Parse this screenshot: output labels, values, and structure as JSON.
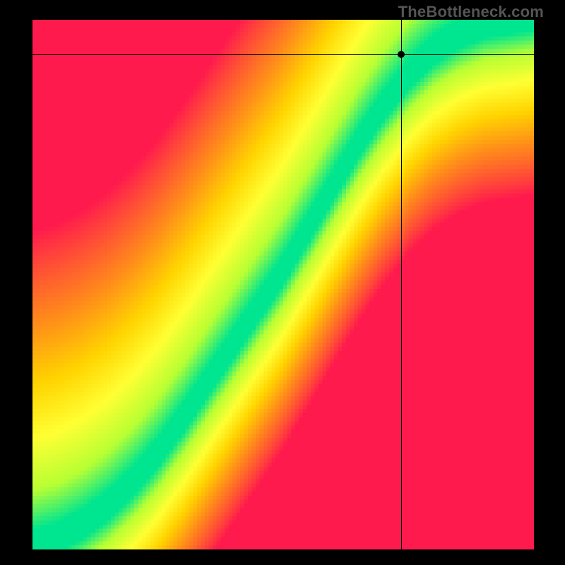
{
  "watermark": "TheBottleneck.com",
  "chart_data": {
    "type": "heatmap",
    "title": "",
    "xlabel": "",
    "ylabel": "",
    "xlim": [
      0,
      1
    ],
    "ylim": [
      0,
      1
    ],
    "grid_resolution": [
      128,
      128
    ],
    "color_scale": {
      "stops": [
        {
          "t": 0.0,
          "color": "#ff1a4d"
        },
        {
          "t": 0.35,
          "color": "#ff8c1a"
        },
        {
          "t": 0.55,
          "color": "#ffd400"
        },
        {
          "t": 0.72,
          "color": "#ffff33"
        },
        {
          "t": 0.88,
          "color": "#b7ff33"
        },
        {
          "t": 1.0,
          "color": "#00e58f"
        }
      ]
    },
    "optimal_curve": {
      "description": "Ideal-balance ridge (x = normalized CPU capability, y = normalized GPU capability). Heat value falls off with distance from this curve.",
      "points": [
        {
          "x": 0.0,
          "y": 0.0
        },
        {
          "x": 0.05,
          "y": 0.015
        },
        {
          "x": 0.1,
          "y": 0.04
        },
        {
          "x": 0.15,
          "y": 0.075
        },
        {
          "x": 0.2,
          "y": 0.12
        },
        {
          "x": 0.25,
          "y": 0.175
        },
        {
          "x": 0.3,
          "y": 0.24
        },
        {
          "x": 0.35,
          "y": 0.31
        },
        {
          "x": 0.4,
          "y": 0.38
        },
        {
          "x": 0.45,
          "y": 0.45
        },
        {
          "x": 0.5,
          "y": 0.52
        },
        {
          "x": 0.55,
          "y": 0.6
        },
        {
          "x": 0.6,
          "y": 0.68
        },
        {
          "x": 0.65,
          "y": 0.76
        },
        {
          "x": 0.7,
          "y": 0.83
        },
        {
          "x": 0.75,
          "y": 0.89
        },
        {
          "x": 0.8,
          "y": 0.935
        },
        {
          "x": 0.85,
          "y": 0.965
        },
        {
          "x": 0.9,
          "y": 0.985
        },
        {
          "x": 1.0,
          "y": 1.0
        }
      ],
      "ridge_half_width": 0.035,
      "max_distance_for_min": 0.6
    },
    "asymmetry": {
      "below_curve_factor": 0.55,
      "above_curve_factor": 1.0
    },
    "marker": {
      "x": 0.735,
      "y": 0.935
    },
    "crosshair": {
      "x": 0.735,
      "y": 0.935
    }
  }
}
